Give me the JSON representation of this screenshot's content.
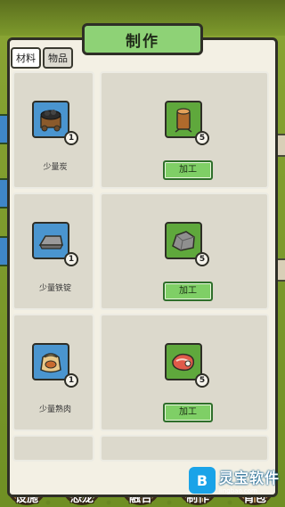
{
  "panel": {
    "title": "制作",
    "tabs": [
      {
        "label": "材料",
        "active": true
      },
      {
        "label": "物品",
        "active": false
      }
    ]
  },
  "recipes": [
    {
      "output": {
        "name": "少量炭",
        "icon": "coal-cart-icon",
        "count": "1"
      },
      "input": {
        "icon": "wood-log-icon",
        "count": "5"
      },
      "button": "加工"
    },
    {
      "output": {
        "name": "少量铁锭",
        "icon": "iron-ingot-icon",
        "count": "1"
      },
      "input": {
        "icon": "stone-icon",
        "count": "5"
      },
      "button": "加工"
    },
    {
      "output": {
        "name": "少量熟肉",
        "icon": "cooked-meat-sack-icon",
        "count": "1"
      },
      "input": {
        "icon": "raw-meat-icon",
        "count": "5"
      },
      "button": "加工"
    }
  ],
  "bottom_nav": [
    "设施",
    "恐龙",
    "融合",
    "制作",
    "背包"
  ],
  "watermark": {
    "name": "灵宝软件",
    "url": "lingbao.com"
  },
  "colors": {
    "panel_bg": "#f3f0e4",
    "title_badge": "#8ed276",
    "craft_button": "#7fcf66",
    "output_slot": "#4a95cf",
    "input_slot": "#5fa83c"
  }
}
